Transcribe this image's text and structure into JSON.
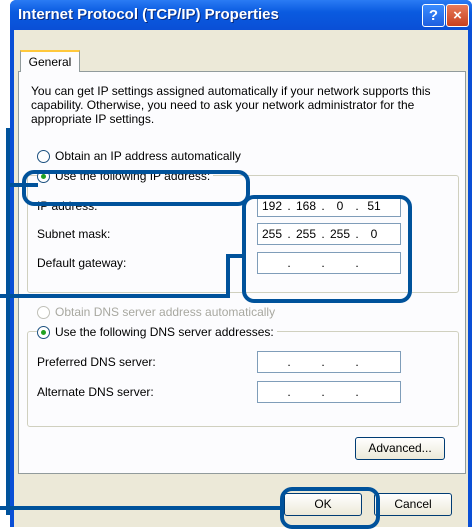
{
  "window": {
    "title": "Internet Protocol (TCP/IP) Properties",
    "help_label": "?",
    "close_label": "×"
  },
  "tabs": [
    {
      "label": "General"
    }
  ],
  "description": "You can get IP settings assigned automatically if your network supports this capability. Otherwise, you need to ask your network administrator for the appropriate IP settings.",
  "ip_mode": {
    "auto_label": "Obtain an IP address automatically",
    "manual_label": "Use the following IP address:",
    "selected": "manual"
  },
  "ip_fields": [
    {
      "label": "IP address:",
      "octets": [
        "192",
        "168",
        "0",
        "51"
      ]
    },
    {
      "label": "Subnet mask:",
      "octets": [
        "255",
        "255",
        "255",
        "0"
      ]
    },
    {
      "label": "Default gateway:",
      "octets": [
        "",
        "",
        "",
        ""
      ]
    }
  ],
  "dns_mode": {
    "auto_label": "Obtain DNS server address automatically",
    "manual_label": "Use the following DNS server addresses:",
    "selected": "manual"
  },
  "dns_fields": [
    {
      "label": "Preferred DNS server:",
      "octets": [
        "",
        "",
        "",
        ""
      ]
    },
    {
      "label": "Alternate DNS server:",
      "octets": [
        "",
        "",
        "",
        ""
      ]
    }
  ],
  "buttons": {
    "advanced": "Advanced...",
    "ok": "OK",
    "cancel": "Cancel"
  },
  "colors": {
    "title_bar": "#0a4fd6",
    "dialog_bg": "#ece9d8",
    "callout": "#00529b"
  }
}
